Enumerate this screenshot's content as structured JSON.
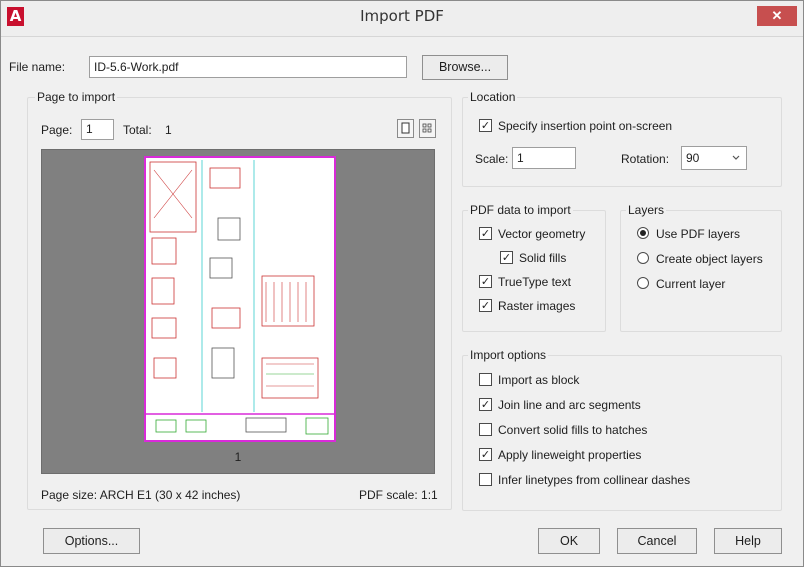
{
  "window": {
    "title": "Import PDF",
    "close_glyph": "✕",
    "app_icon_letter": "A"
  },
  "file": {
    "label": "File name:",
    "value": "ID-5.6-Work.pdf",
    "browse_label": "Browse..."
  },
  "page_to_import": {
    "group_label": "Page to import",
    "page_label": "Page:",
    "page_value": "1",
    "total_label": "Total:",
    "total_value": "1",
    "thumbnail_number": "1",
    "page_size": "Page size: ARCH E1 (30 x 42 inches)",
    "pdf_scale": "PDF scale: 1:1"
  },
  "location": {
    "group_label": "Location",
    "specify_label": "Specify insertion point on-screen",
    "specify_checked": true,
    "scale_label": "Scale:",
    "scale_value": "1",
    "rotation_label": "Rotation:",
    "rotation_value": "90"
  },
  "pdf_data": {
    "group_label": "PDF data to import",
    "vector_label": "Vector geometry",
    "vector_checked": true,
    "solid_fills_label": "Solid fills",
    "solid_fills_checked": true,
    "truetype_label": "TrueType text",
    "truetype_checked": true,
    "raster_label": "Raster images",
    "raster_checked": true
  },
  "layers": {
    "group_label": "Layers",
    "use_pdf_label": "Use PDF layers",
    "create_object_label": "Create object layers",
    "current_label": "Current layer",
    "selected": "use_pdf"
  },
  "import_options": {
    "group_label": "Import options",
    "block_label": "Import as block",
    "block_checked": false,
    "join_label": "Join line and arc segments",
    "join_checked": true,
    "convert_label": "Convert solid fills to hatches",
    "convert_checked": false,
    "lineweight_label": "Apply lineweight properties",
    "lineweight_checked": true,
    "linetypes_label": "Infer linetypes from collinear dashes",
    "linetypes_checked": false
  },
  "buttons": {
    "options": "Options...",
    "ok": "OK",
    "cancel": "Cancel",
    "help": "Help"
  },
  "icons": {
    "check": "✓",
    "dropdown": "chevron-down-icon",
    "single_page": "single-page-view-icon",
    "grid": "grid-view-icon"
  },
  "colors": {
    "sheet_border": "#d92ad9",
    "close_button": "#c74f4f",
    "app_icon": "#c8102e",
    "preview_bg": "#808080"
  }
}
